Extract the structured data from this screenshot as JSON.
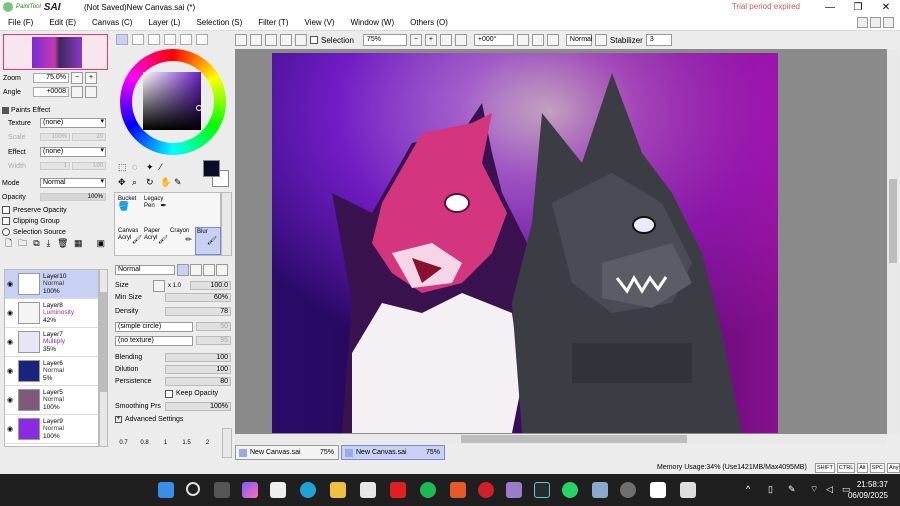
{
  "titlebar": {
    "app_name": "PaintTool",
    "app_short": "SAI",
    "doc_title": "(Not Saved)New Canvas.sai (*)",
    "trial_notice": "Trial period expired",
    "minimize": "—",
    "maximize": "❐",
    "close": "✕"
  },
  "menu": [
    "File (F)",
    "Edit (E)",
    "Canvas (C)",
    "Layer (L)",
    "Selection (S)",
    "Filter (T)",
    "View (V)",
    "Window (W)",
    "Others (O)"
  ],
  "toolbar": {
    "selection_label": "Selection",
    "zoom_value": "75%",
    "rotation_value": "+000°",
    "blend_mode": "Normal",
    "stabilizer_label": "Stabilizer",
    "stabilizer_value": "3"
  },
  "navigator": {
    "zoom_label": "Zoom",
    "zoom_value": "75.0%",
    "angle_label": "Angle",
    "angle_value": "+0008"
  },
  "paint_effect": {
    "header": "Paints Effect",
    "texture_label": "Texture",
    "texture_value": "(none)",
    "scale_label": "Scale",
    "scale_value": "100%",
    "scale_num": "20",
    "effect_label": "Effect",
    "effect_value": "(none)",
    "width_label": "Width",
    "width_value": "1",
    "width_num": "100"
  },
  "layer_props": {
    "mode_label": "Mode",
    "mode_value": "Normal",
    "opacity_label": "Opacity",
    "opacity_value": "100%",
    "preserve_opacity": "Preserve Opacity",
    "clipping_group": "Clipping Group",
    "selection_source": "Selection Source"
  },
  "layers": [
    {
      "name": "Layer10",
      "blend": "Normal",
      "opacity": "100%",
      "selected": true,
      "thumb": "#ffffff"
    },
    {
      "name": "Layer8",
      "blend": "Luminosity",
      "opacity": "42%",
      "selected": false,
      "thumb": "#f4f4f4"
    },
    {
      "name": "Layer7",
      "blend": "Multiply",
      "opacity": "35%",
      "selected": false,
      "thumb": "#e8e6f4"
    },
    {
      "name": "Layer6",
      "blend": "Normal",
      "opacity": "5%",
      "selected": false,
      "thumb": "#1a237e"
    },
    {
      "name": "Layer5",
      "blend": "Normal",
      "opacity": "100%",
      "selected": false,
      "thumb": "#7d5a7a"
    },
    {
      "name": "Layer9",
      "blend": "Normal",
      "opacity": "100%",
      "selected": false,
      "thumb": "#8a2be2"
    }
  ],
  "colors": {
    "foreground": "#0d0b2a",
    "background": "#ffffff",
    "accent_selection": "#c8d0f4"
  },
  "brushes": [
    {
      "name": "Bucket",
      "sub": ""
    },
    {
      "name": "Legacy",
      "sub": "Pen"
    },
    {
      "name": "Canvas",
      "sub": "Acryl"
    },
    {
      "name": "Paper",
      "sub": "Acryl"
    },
    {
      "name": "Crayon",
      "sub": ""
    },
    {
      "name": "Blur",
      "sub": ""
    }
  ],
  "brush_settings": {
    "blend_mode": "Normal",
    "size_label": "Size",
    "size_mult": "x 1.0",
    "size_value": "100.0",
    "min_size_label": "Min Size",
    "min_size_value": "60%",
    "density_label": "Density",
    "density_value": "78",
    "shape": "(simple circle)",
    "shape_num": "50",
    "texture": "(no texture)",
    "texture_num": "95",
    "blending_label": "Blending",
    "blending_value": "100",
    "dilution_label": "Dilution",
    "dilution_value": "100",
    "persistence_label": "Persistence",
    "persistence_value": "80",
    "keep_opacity": "Keep Opacity",
    "smoothing_label": "Smoothing Prs",
    "smoothing_value": "100%",
    "advanced": "Advanced Settings"
  },
  "size_presets": [
    "0.7",
    "0.8",
    "1",
    "1.5",
    "2"
  ],
  "doc_tabs": [
    {
      "name": "New Canvas.sai",
      "zoom": "75%",
      "active": false
    },
    {
      "name": "New Canvas.sai",
      "zoom": "75%",
      "active": true
    }
  ],
  "status": {
    "memory": "Memory Usage:34% (Use1421MB/Max4095MB)",
    "keys": [
      "SHIFT",
      "CTRL",
      "Alt",
      "SPC",
      "Any"
    ]
  },
  "clock": {
    "time": "21:58:37",
    "date": "06/09/2025"
  }
}
